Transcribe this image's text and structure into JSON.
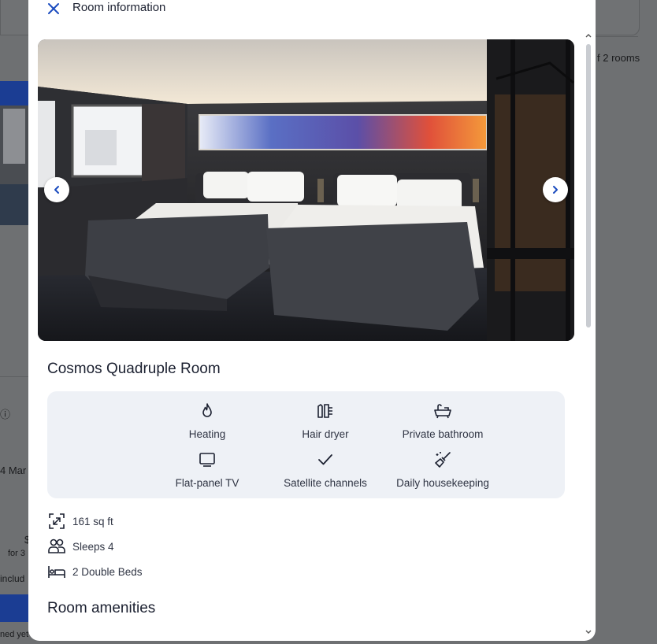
{
  "background": {
    "right_text": "f 2 rooms",
    "left_snippets": [
      "4 Mar",
      "for 3",
      "includ",
      "ned yet"
    ]
  },
  "modal": {
    "title": "Room information",
    "close_icon": "close-icon",
    "gallery": {
      "prev_icon": "chevron-left-icon",
      "next_icon": "chevron-right-icon"
    },
    "room_name": "Cosmos Quadruple Room",
    "amenities": [
      {
        "icon": "flame-icon",
        "label": "Heating"
      },
      {
        "icon": "hair-dryer-icon",
        "label": "Hair dryer"
      },
      {
        "icon": "bathtub-icon",
        "label": "Private bathroom"
      },
      {
        "icon": "tv-icon",
        "label": "Flat-panel TV"
      },
      {
        "icon": "check-icon",
        "label": "Satellite channels"
      },
      {
        "icon": "cleaning-icon",
        "label": "Daily housekeeping"
      }
    ],
    "facts": [
      {
        "icon": "expand-icon",
        "text": "161 sq ft"
      },
      {
        "icon": "people-icon",
        "text": "Sleeps 4"
      },
      {
        "icon": "bed-icon",
        "text": "2 Double Beds"
      }
    ],
    "amenities_section_title": "Room amenities"
  },
  "colors": {
    "accent": "#1a4bbf",
    "text_dark": "#1b2030",
    "amenity_bg": "#eef1f6",
    "overlay": "#6f7173"
  }
}
